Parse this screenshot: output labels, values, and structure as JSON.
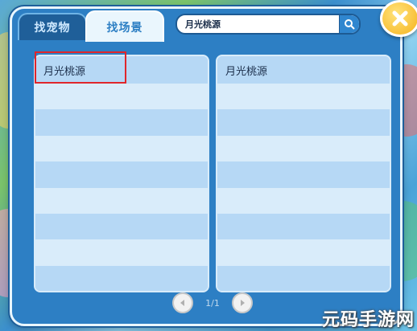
{
  "tabs": [
    {
      "label": "找宠物",
      "active": false
    },
    {
      "label": "找场景",
      "active": true
    }
  ],
  "search": {
    "value": "月光桃源",
    "icon": "search-icon"
  },
  "close": {
    "icon": "close-icon"
  },
  "lists": {
    "left": {
      "rows": [
        "月光桃源",
        "",
        "",
        "",
        "",
        "",
        "",
        "",
        ""
      ]
    },
    "right": {
      "rows": [
        "月光桃源",
        "",
        "",
        "",
        "",
        "",
        "",
        "",
        ""
      ]
    }
  },
  "pager": {
    "text": "1/1",
    "prev_icon": "left-arrow-icon",
    "next_icon": "right-arrow-icon"
  },
  "watermark": {
    "text": "元码手游网"
  },
  "colors": {
    "panel": "#2d7fc4",
    "highlight": "#e0262b",
    "close": "#f5b21d"
  }
}
